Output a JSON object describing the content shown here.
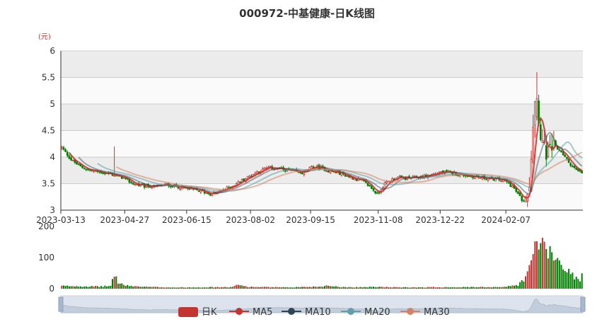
{
  "chart_data": {
    "type": "candlestick",
    "title": "000972-中基健康-日K线图",
    "unit": "(元)",
    "price_axis": {
      "min": 3,
      "max": 6,
      "ticks": [
        "3",
        "3.5",
        "4",
        "4.5",
        "5",
        "5.5",
        "6"
      ]
    },
    "volume_axis": {
      "min": 0,
      "max": 200,
      "ticks": [
        "0",
        "100",
        "200"
      ]
    },
    "x_ticks": [
      "2023-03-13",
      "2023-04-27",
      "2023-06-15",
      "2023-08-02",
      "2023-09-15",
      "2023-11-08",
      "2023-12-22",
      "2024-02-07"
    ],
    "series": [
      {
        "name": "日K",
        "color": "#c23531"
      },
      {
        "name": "MA5",
        "color": "#c23531"
      },
      {
        "name": "MA10",
        "color": "#2f4554"
      },
      {
        "name": "MA20",
        "color": "#61a0a8"
      },
      {
        "name": "MA30",
        "color": "#d48265"
      }
    ],
    "up_color": "#c23531",
    "down_color": "#008000",
    "approx_close_path": [
      [
        0,
        4.18
      ],
      [
        5,
        3.95
      ],
      [
        10,
        3.82
      ],
      [
        15,
        3.75
      ],
      [
        20,
        3.72
      ],
      [
        26,
        3.68
      ],
      [
        32,
        3.62
      ],
      [
        38,
        3.5
      ],
      [
        44,
        3.45
      ],
      [
        50,
        3.45
      ],
      [
        56,
        3.48
      ],
      [
        62,
        3.44
      ],
      [
        68,
        3.4
      ],
      [
        74,
        3.36
      ],
      [
        80,
        3.3
      ],
      [
        86,
        3.38
      ],
      [
        92,
        3.48
      ],
      [
        98,
        3.6
      ],
      [
        104,
        3.72
      ],
      [
        110,
        3.8
      ],
      [
        116,
        3.78
      ],
      [
        122,
        3.74
      ],
      [
        128,
        3.7
      ],
      [
        134,
        3.82
      ],
      [
        138,
        3.8
      ],
      [
        142,
        3.74
      ],
      [
        148,
        3.7
      ],
      [
        154,
        3.62
      ],
      [
        160,
        3.55
      ],
      [
        164,
        3.45
      ],
      [
        168,
        3.3
      ],
      [
        172,
        3.5
      ],
      [
        178,
        3.62
      ],
      [
        184,
        3.6
      ],
      [
        190,
        3.62
      ],
      [
        196,
        3.66
      ],
      [
        202,
        3.72
      ],
      [
        208,
        3.7
      ],
      [
        214,
        3.66
      ],
      [
        220,
        3.63
      ],
      [
        226,
        3.6
      ],
      [
        232,
        3.58
      ],
      [
        236,
        3.55
      ],
      [
        240,
        3.45
      ],
      [
        243,
        3.3
      ],
      [
        246,
        3.15
      ],
      [
        249,
        3.5
      ],
      [
        251,
        4.6
      ],
      [
        253,
        5.1
      ],
      [
        255,
        4.4
      ],
      [
        258,
        4.05
      ],
      [
        262,
        4.2
      ],
      [
        266,
        4.1
      ],
      [
        270,
        3.9
      ],
      [
        274,
        3.75
      ],
      [
        277,
        3.7
      ]
    ],
    "volume_profile": [
      [
        0,
        9
      ],
      [
        10,
        8
      ],
      [
        20,
        7
      ],
      [
        26,
        9
      ],
      [
        28,
        48
      ],
      [
        30,
        20
      ],
      [
        34,
        10
      ],
      [
        44,
        6
      ],
      [
        60,
        4
      ],
      [
        80,
        5
      ],
      [
        90,
        5
      ],
      [
        94,
        12
      ],
      [
        100,
        6
      ],
      [
        120,
        4
      ],
      [
        130,
        6
      ],
      [
        138,
        7
      ],
      [
        142,
        10
      ],
      [
        150,
        5
      ],
      [
        160,
        5
      ],
      [
        170,
        6
      ],
      [
        180,
        4
      ],
      [
        200,
        5
      ],
      [
        220,
        5
      ],
      [
        236,
        6
      ],
      [
        243,
        12
      ],
      [
        246,
        30
      ],
      [
        248,
        48
      ],
      [
        250,
        85
      ],
      [
        252,
        140
      ],
      [
        254,
        155
      ],
      [
        256,
        140
      ],
      [
        258,
        125
      ],
      [
        260,
        110
      ],
      [
        262,
        100
      ],
      [
        264,
        90
      ],
      [
        266,
        80
      ],
      [
        268,
        70
      ],
      [
        270,
        55
      ],
      [
        272,
        45
      ],
      [
        274,
        35
      ],
      [
        276,
        25
      ],
      [
        277,
        45
      ]
    ]
  }
}
